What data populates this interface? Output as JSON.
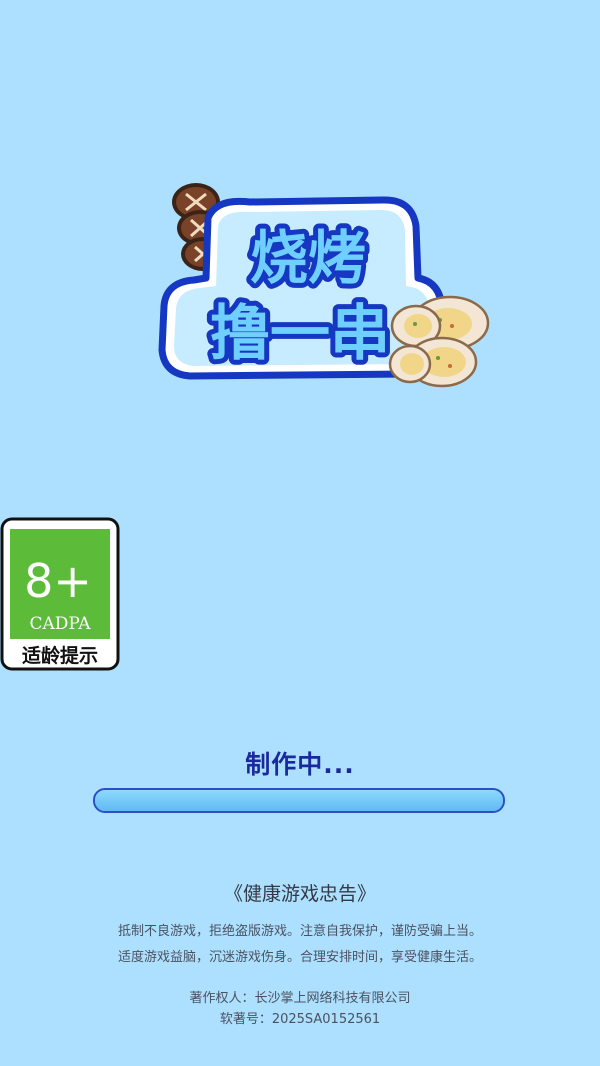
{
  "logo": {
    "title_line1": "烧烤",
    "title_line2": "撸一串"
  },
  "age_rating": {
    "age": "8+",
    "org": "CADPA",
    "caption": "适龄提示"
  },
  "loading": {
    "label": "制作中...",
    "progress": 1.0
  },
  "health_advice": {
    "title": "《健康游戏忠告》",
    "line1": "抵制不良游戏，拒绝盗版游戏。注意自我保护，谨防受骗上当。",
    "line2": "适度游戏益脑，沉迷游戏伤身。合理安排时间，享受健康生活。"
  },
  "copyright": {
    "owner": "著作权人：长沙掌上网络科技有限公司",
    "registration": "软著号：2025SA0152561"
  },
  "colors": {
    "background": "#ade0fe",
    "title_blue": "#1a2a9c",
    "logo_outline": "#1537c2",
    "logo_fill": "#6fd0ff",
    "badge_green": "#5dbb3a"
  }
}
